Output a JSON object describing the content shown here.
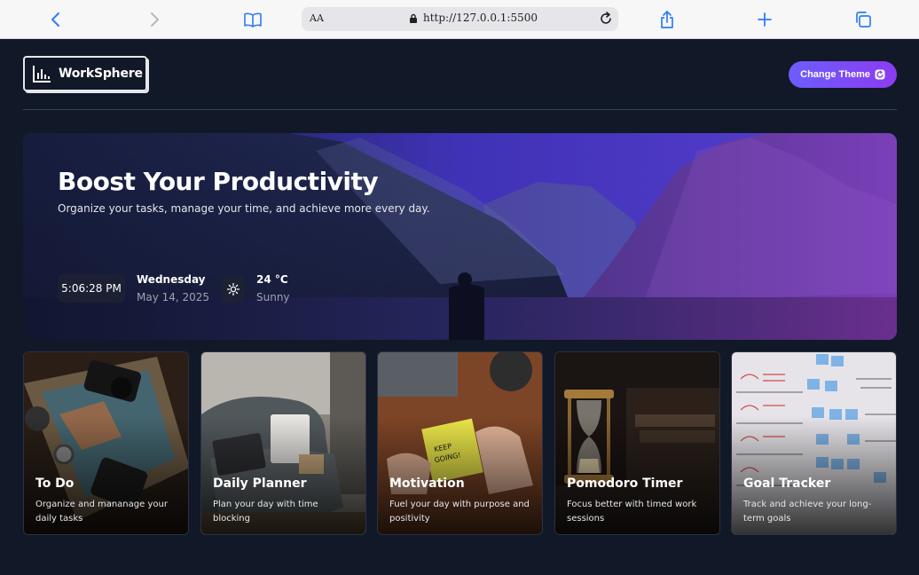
{
  "browser": {
    "text_size_label": "AA",
    "url": "http://127.0.0.1:5500"
  },
  "header": {
    "logo_text": "WorkSphere",
    "theme_button_label": "Change Theme"
  },
  "hero": {
    "title": "Boost Your Productivity",
    "subtitle": "Organize your tasks, manage your time, and achieve more every day.",
    "time": "5:06:28 PM",
    "weekday": "Wednesday",
    "date": "May 14, 2025",
    "temperature": "24 °C",
    "condition": "Sunny"
  },
  "cards": [
    {
      "title": "To Do",
      "description": "Organize and mananage your daily tasks"
    },
    {
      "title": "Daily Planner",
      "description": "Plan your day with time blocking"
    },
    {
      "title": "Motivation",
      "description": "Fuel your day with purpose and positivity"
    },
    {
      "title": "Pomodoro Timer",
      "description": "Focus better with timed work sessions"
    },
    {
      "title": "Goal Tracker",
      "description": "Track and achieve your long-term goals"
    }
  ],
  "colors": {
    "page_background": "#111827",
    "accent_gradient_start": "#6d5dfc",
    "accent_gradient_end": "#8b3cf0",
    "browser_icon_blue": "#2f7cf6"
  }
}
